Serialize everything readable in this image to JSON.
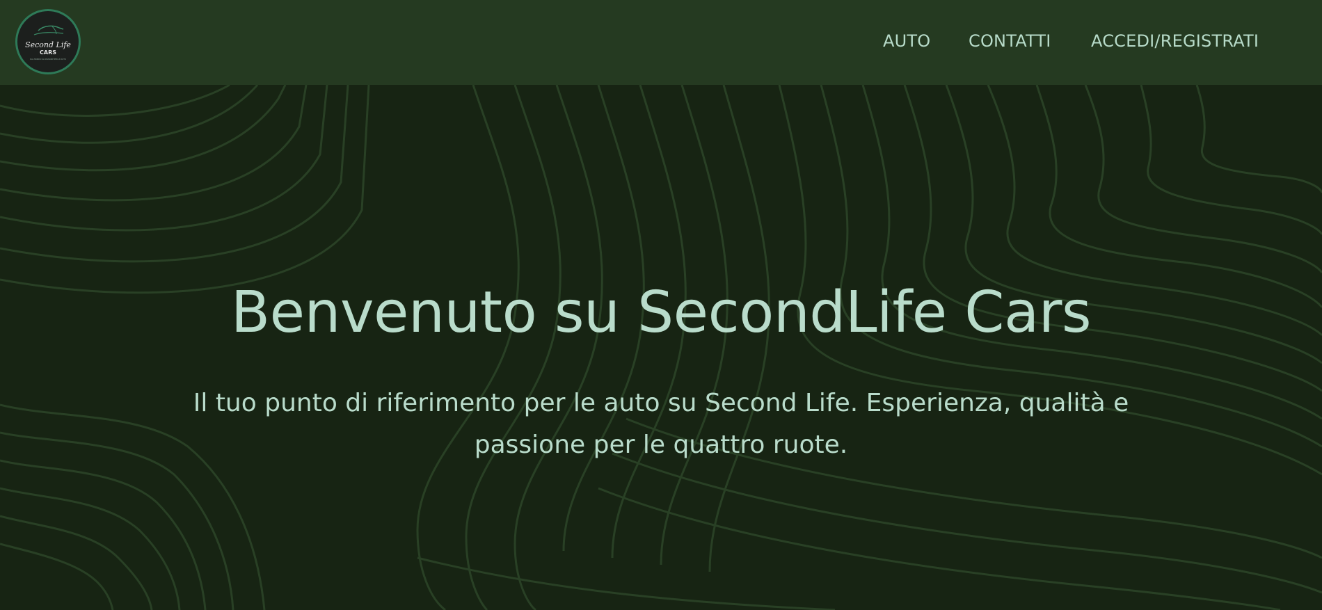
{
  "header": {
    "logo": {
      "line1": "Second Life",
      "line2": "CARS",
      "tagline": "DAL MONDO SL PASSIONE PER LE AUTO"
    },
    "nav": [
      {
        "label": "AUTO"
      },
      {
        "label": "CONTATTI"
      },
      {
        "label": "ACCEDI/REGISTRATI"
      }
    ]
  },
  "hero": {
    "title": "Benvenuto su SecondLife Cars",
    "subtitle": "Il tuo punto di riferimento per le auto su Second Life. Esperienza, qualità e passione per le quattro ruote."
  },
  "colors": {
    "header_bg": "#253a21",
    "page_bg": "#172413",
    "text": "#b9dccb",
    "line": "#2b4427",
    "logo_ring": "#2e7a58"
  },
  "icons": {
    "logo": "car-logo-icon"
  }
}
